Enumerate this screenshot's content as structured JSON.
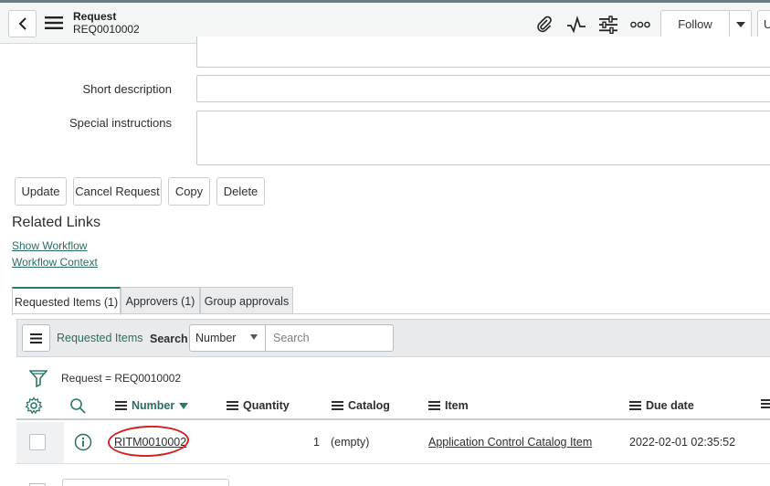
{
  "header": {
    "title": "Request",
    "number": "REQ0010002",
    "follow_label": "Follow",
    "cut_button_label": "U"
  },
  "form": {
    "short_description_label": "Short description",
    "short_description_value": "",
    "special_instructions_label": "Special instructions",
    "special_instructions_value": ""
  },
  "actions": {
    "update": "Update",
    "cancel_request": "Cancel Request",
    "copy": "Copy",
    "delete": "Delete"
  },
  "related_links": {
    "title": "Related Links",
    "show_workflow": "Show Workflow",
    "workflow_context": "Workflow Context"
  },
  "tabs": [
    {
      "label": "Requested Items (1)",
      "active": true
    },
    {
      "label": "Approvers (1)",
      "active": false
    },
    {
      "label": "Group approvals",
      "active": false
    }
  ],
  "list": {
    "title": "Requested Items",
    "search_label": "Search",
    "search_field": "Number",
    "search_placeholder": "Search",
    "breadcrumb": "Request = REQ0010002",
    "columns": {
      "number": "Number",
      "quantity": "Quantity",
      "catalog": "Catalog",
      "item": "Item",
      "due_date": "Due date"
    },
    "rows": [
      {
        "number": "RITM0010002",
        "quantity": "1",
        "catalog": "(empty)",
        "item": "Application Control Catalog Item",
        "due_date": "2022-02-01 02:35:52"
      }
    ]
  },
  "colors": {
    "accent": "#2a7a6c",
    "link": "#2a6e62",
    "annotation": "#d42020"
  }
}
